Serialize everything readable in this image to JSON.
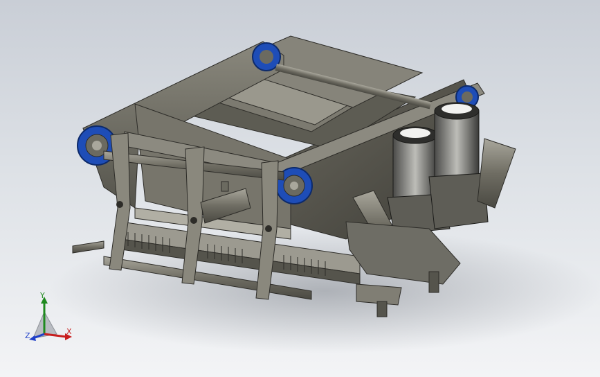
{
  "triad": {
    "x_label": "X",
    "y_label": "Y",
    "z_label": "Z"
  },
  "colors": {
    "background_top": "#c9ced6",
    "background_bottom": "#f3f4f6",
    "frame_steel": "#6b6a60",
    "bearing_blue": "#1e4db7",
    "axis_x": "#c81e1e",
    "axis_y": "#1f8a1f",
    "axis_z": "#1f3fc8"
  }
}
